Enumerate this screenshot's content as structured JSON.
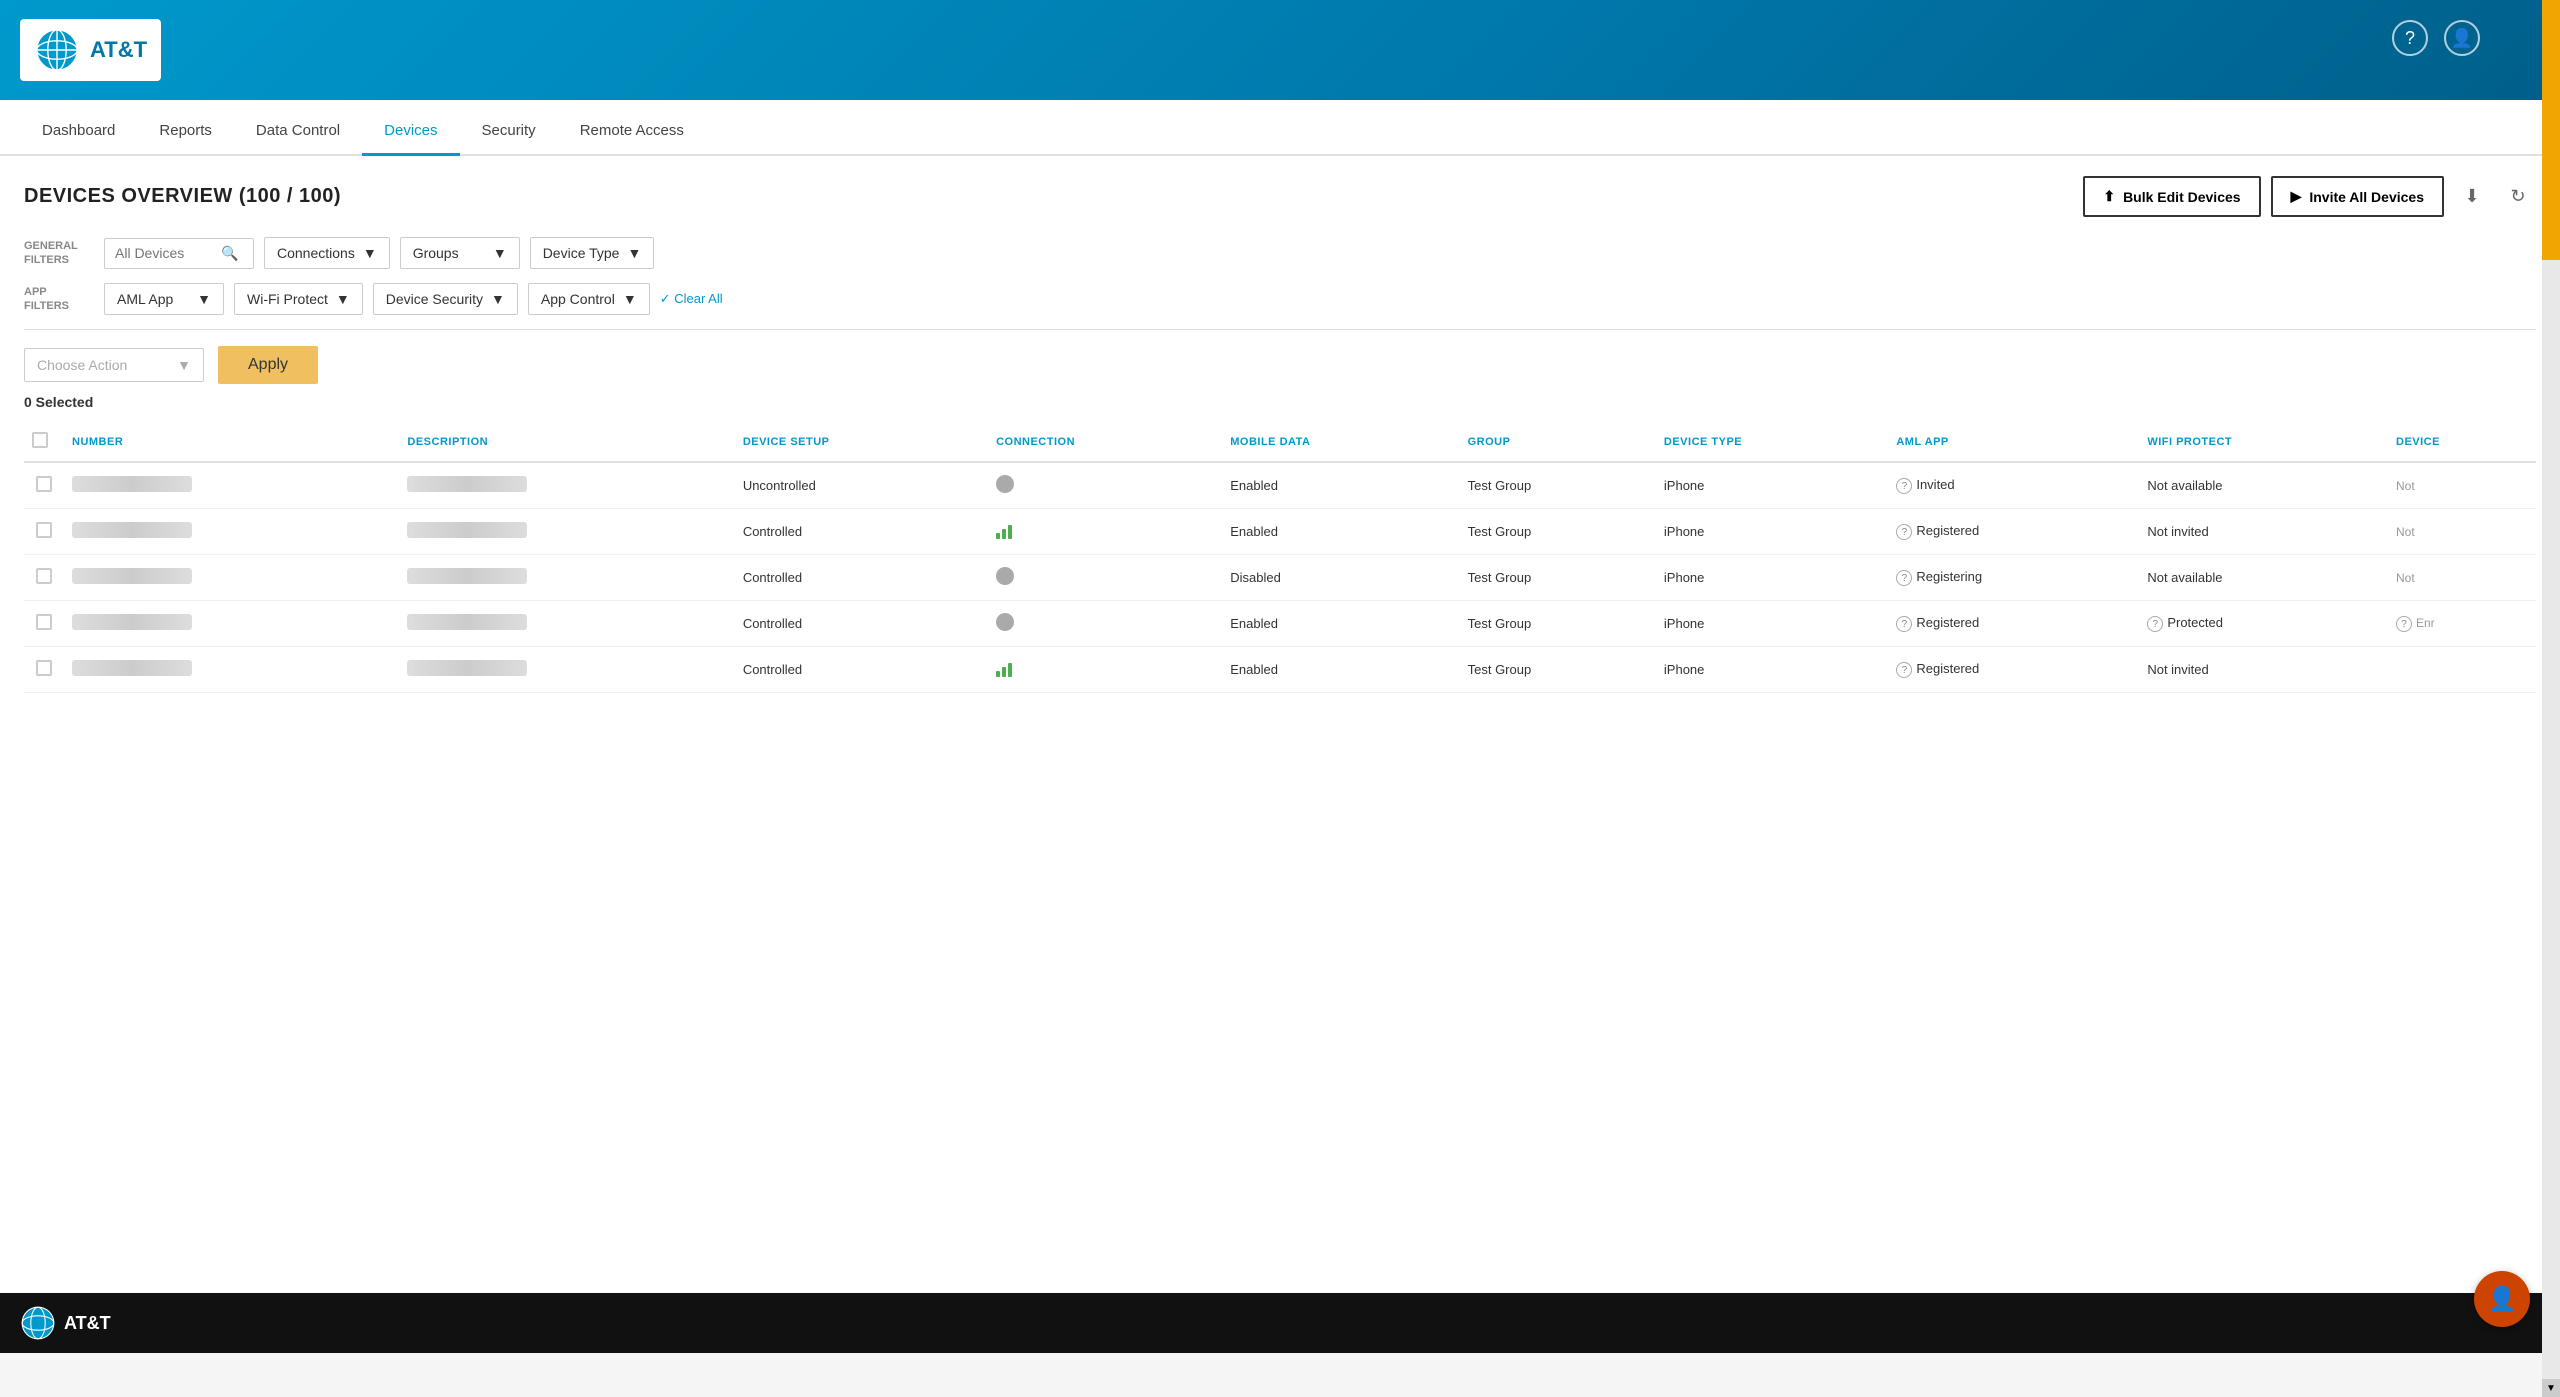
{
  "brand": {
    "name": "AT&T",
    "logo_alt": "AT&T Globe"
  },
  "header": {
    "help_label": "?",
    "user_label": "👤"
  },
  "nav": {
    "items": [
      {
        "label": "Dashboard",
        "active": false
      },
      {
        "label": "Reports",
        "active": false
      },
      {
        "label": "Data Control",
        "active": false
      },
      {
        "label": "Devices",
        "active": true
      },
      {
        "label": "Security",
        "active": false
      },
      {
        "label": "Remote Access",
        "active": false
      }
    ]
  },
  "page": {
    "title": "DEVICES OVERVIEW (100 / 100)",
    "bulk_edit_label": "Bulk Edit Devices",
    "invite_all_label": "Invite All Devices"
  },
  "general_filters": {
    "label": "GENERAL\nFILTERS",
    "search_placeholder": "All Devices",
    "connections_label": "Connections",
    "groups_label": "Groups",
    "device_type_label": "Device Type"
  },
  "app_filters": {
    "label": "APP\nFILTERS",
    "aml_app_label": "AML App",
    "wifi_protect_label": "Wi-Fi Protect",
    "device_security_label": "Device Security",
    "app_control_label": "App Control",
    "clear_all_label": "Clear All"
  },
  "actions": {
    "choose_action_placeholder": "Choose Action",
    "apply_label": "Apply"
  },
  "table": {
    "selected_count": "0 Selected",
    "columns": [
      {
        "key": "checkbox",
        "label": ""
      },
      {
        "key": "number",
        "label": "NUMBER"
      },
      {
        "key": "description",
        "label": "DESCRIPTION"
      },
      {
        "key": "device_setup",
        "label": "DEVICE SETUP"
      },
      {
        "key": "connection",
        "label": "CONNECTION"
      },
      {
        "key": "mobile_data",
        "label": "MOBILE DATA"
      },
      {
        "key": "group",
        "label": "GROUP"
      },
      {
        "key": "device_type",
        "label": "DEVICE TYPE"
      },
      {
        "key": "aml_app",
        "label": "AML APP"
      },
      {
        "key": "wifi_protect",
        "label": "WIFI PROTECT"
      },
      {
        "key": "device",
        "label": "DEVICE"
      }
    ],
    "rows": [
      {
        "device_setup": "Uncontrolled",
        "connection_type": "dot",
        "mobile_data": "Enabled",
        "group": "Test Group",
        "device_type": "iPhone",
        "aml_app": "Invited",
        "wifi_protect": "Not available",
        "device_truncated": "Not"
      },
      {
        "device_setup": "Controlled",
        "connection_type": "bars",
        "mobile_data": "Enabled",
        "group": "Test Group",
        "device_type": "iPhone",
        "aml_app": "Registered",
        "wifi_protect": "Not invited",
        "device_truncated": "Not"
      },
      {
        "device_setup": "Controlled",
        "connection_type": "dot",
        "mobile_data": "Disabled",
        "group": "Test Group",
        "device_type": "iPhone",
        "aml_app": "Registering",
        "wifi_protect": "Not available",
        "device_truncated": "Not"
      },
      {
        "device_setup": "Controlled",
        "connection_type": "dot",
        "mobile_data": "Enabled",
        "group": "Test Group",
        "device_type": "iPhone",
        "aml_app": "Registered",
        "wifi_protect": "Protected",
        "device_truncated": "Enr"
      },
      {
        "device_setup": "Controlled",
        "connection_type": "bars",
        "mobile_data": "Enabled",
        "group": "Test Group",
        "device_type": "iPhone",
        "aml_app": "Registered",
        "wifi_protect": "Not invited",
        "device_truncated": ""
      }
    ]
  },
  "footer": {
    "brand": "AT&T"
  },
  "chat_icon": "👤"
}
